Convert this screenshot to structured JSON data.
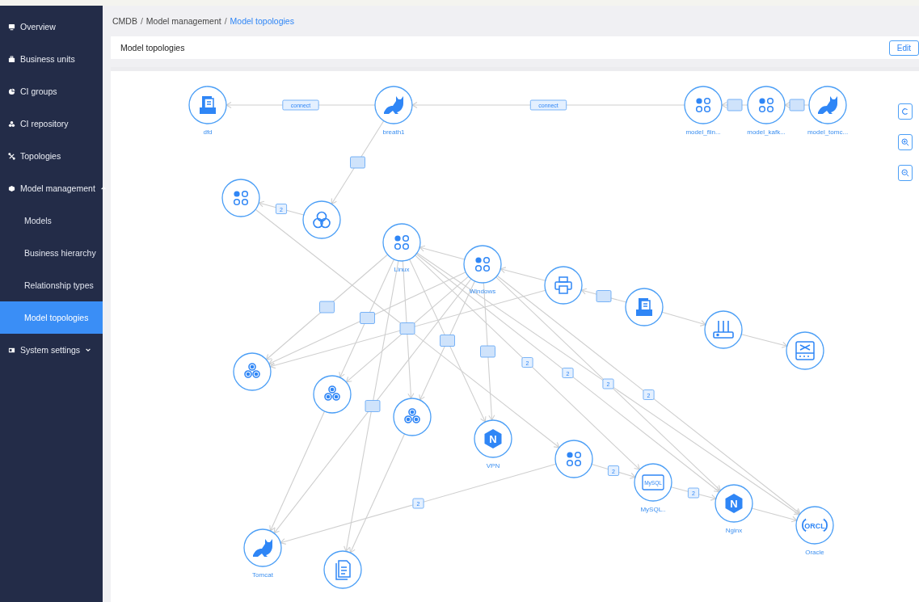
{
  "sidebar": {
    "items": [
      {
        "label": "Overview",
        "selected": false
      },
      {
        "label": "Business units",
        "selected": false
      },
      {
        "label": "CI groups",
        "selected": false
      },
      {
        "label": "CI repository",
        "selected": false
      },
      {
        "label": "Topologies",
        "selected": false
      },
      {
        "label": "Model management",
        "selected": false,
        "expanded": true,
        "children": [
          {
            "label": "Models",
            "selected": false
          },
          {
            "label": "Business hierarchy",
            "selected": false
          },
          {
            "label": "Relationship types",
            "selected": false
          },
          {
            "label": "Model topologies",
            "selected": true
          }
        ]
      },
      {
        "label": "System settings",
        "selected": false,
        "expanded": false
      }
    ]
  },
  "breadcrumb": {
    "separator": "/",
    "items": [
      {
        "label": "CMDB",
        "selected": false
      },
      {
        "label": "Model management",
        "selected": false
      },
      {
        "label": "Model topologies",
        "selected": true
      }
    ]
  },
  "header": {
    "title": "Model topologies",
    "edit_button": "Edit"
  },
  "topology": {
    "nodes": [
      {
        "kind": "doc-stack",
        "label": "dfd"
      },
      {
        "kind": "cat",
        "label": "breath1"
      },
      {
        "kind": "apps",
        "label": "model_flin..."
      },
      {
        "kind": "apps",
        "label": "model_kafk..."
      },
      {
        "kind": "cat",
        "label": "model_tomc..."
      },
      {
        "kind": "apps"
      },
      {
        "kind": "cloud"
      },
      {
        "kind": "apps",
        "label": "Linux"
      },
      {
        "kind": "apps",
        "label": "Windows"
      },
      {
        "kind": "printer"
      },
      {
        "kind": "doc-stack"
      },
      {
        "kind": "router"
      },
      {
        "kind": "switch"
      },
      {
        "kind": "hexes"
      },
      {
        "kind": "hexes"
      },
      {
        "kind": "hexes"
      },
      {
        "kind": "nginx",
        "icon_text": "N",
        "label": "VPN"
      },
      {
        "kind": "apps"
      },
      {
        "kind": "mysql",
        "icon_text": "MySQL",
        "label": "MySQL.."
      },
      {
        "kind": "nginx",
        "icon_text": "N",
        "label": "Nginx"
      },
      {
        "kind": "oracle",
        "icon_text": "ORCL",
        "label": "Oracle"
      },
      {
        "kind": "cat",
        "label": "Tomcat"
      },
      {
        "kind": "document"
      }
    ],
    "edges": [
      {
        "kind": "labelled",
        "label": "connect"
      },
      {
        "kind": "labelled",
        "label": "connect"
      },
      {
        "kind": "blank"
      },
      {
        "kind": "blank"
      },
      {
        "kind": "blank"
      },
      {
        "kind": "labelled",
        "label": "2"
      },
      {
        "kind": "blank"
      },
      {
        "kind": "blank"
      },
      {
        "kind": "plain"
      },
      {
        "kind": "plain"
      },
      {
        "kind": "plain"
      },
      {
        "kind": "blank"
      },
      {
        "kind": "plain"
      },
      {
        "kind": "blank"
      },
      {
        "kind": "blank"
      },
      {
        "kind": "plain"
      },
      {
        "kind": "plain"
      },
      {
        "kind": "plain"
      },
      {
        "kind": "blank"
      },
      {
        "kind": "plain"
      },
      {
        "kind": "plain"
      },
      {
        "kind": "labelled",
        "label": "2"
      },
      {
        "kind": "labelled",
        "label": "2"
      },
      {
        "kind": "labelled",
        "label": "2"
      },
      {
        "kind": "labelled",
        "label": "2"
      },
      {
        "kind": "plain"
      },
      {
        "kind": "labelled",
        "label": "2"
      },
      {
        "kind": "labelled",
        "label": "2"
      },
      {
        "kind": "plain"
      },
      {
        "kind": "labelled",
        "label": "2"
      },
      {
        "kind": "plain"
      },
      {
        "kind": "blank"
      },
      {
        "kind": "plain"
      },
      {
        "kind": "plain"
      }
    ]
  },
  "zoom_controls": [
    {
      "kind": "reset"
    },
    {
      "kind": "zoom-in"
    },
    {
      "kind": "zoom-out"
    }
  ]
}
